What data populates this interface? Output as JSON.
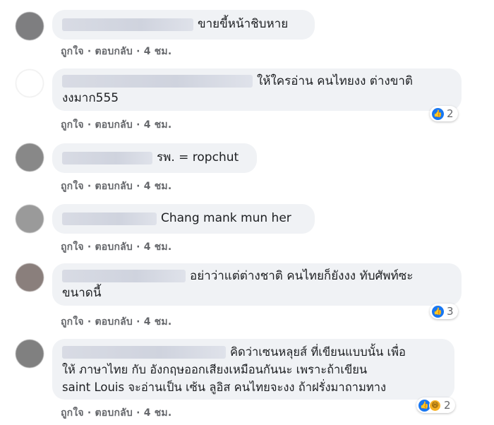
{
  "actions": {
    "like": "ถูกใจ",
    "reply": "ตอบกลับ",
    "separator": "·",
    "time": "4 ชม."
  },
  "comments": [
    {
      "text": "ขายขี้หน้าชิบหาย",
      "reactions": null
    },
    {
      "text_line1": "ให้ใครอ่าน คนไทยงง ต่างขาติ",
      "text_line2": "งงมาก555",
      "reactions": "2"
    },
    {
      "text": "รพ. = ropchut",
      "reactions": null
    },
    {
      "text": "Chang mank mun her",
      "reactions": null
    },
    {
      "text_line1": "อย่าว่าแต่ต่างชาติ คนไทยก็ยังงง ทับศัพท์ซะ",
      "text_line2": "ขนาดนี้",
      "reactions": "3"
    },
    {
      "text_line1": "คิดว่าเซนหลุยส์ ที่เขียนแบบนั้น เพื่อ",
      "text_line2": "ให้ ภาษาไทย กับ อังกฤษออกเสียงเหมือนกันนะ เพราะถ้าเขียน",
      "text_line3": "saint Louis จะอ่านเป็น เซ้น ลูอิส คนไทยจะงง ถ้าฝรั่งมาถามทาง",
      "reactions": "2"
    }
  ],
  "icons": {
    "like": "thumbs-up-icon",
    "haha": "haha-icon"
  },
  "colors": {
    "bubble": "#f0f2f5",
    "action_text": "#65676b",
    "like_blue": "#1877f2"
  }
}
